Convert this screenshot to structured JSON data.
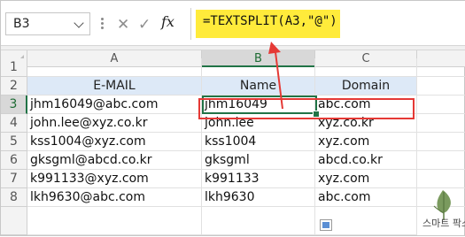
{
  "name_box": {
    "value": "B3"
  },
  "formula_bar": {
    "cancel_glyph": "✕",
    "enter_glyph": "✓",
    "fx_label": "fx",
    "formula": "=TEXTSPLIT(A3,\"@\")"
  },
  "columns": [
    "A",
    "B",
    "C"
  ],
  "rows": [
    "1",
    "2",
    "3",
    "4",
    "5",
    "6",
    "7",
    "8"
  ],
  "headers": {
    "email": "E-MAIL",
    "name": "Name",
    "domain": "Domain"
  },
  "data": [
    {
      "row": "3",
      "email": "jhm16049@abc.com",
      "name": "jhm16049",
      "domain": "abc.com"
    },
    {
      "row": "4",
      "email": "john.lee@xyz.co.kr",
      "name": "john.lee",
      "domain": "xyz.co.kr"
    },
    {
      "row": "5",
      "email": "kss1004@xyz.com",
      "name": "kss1004",
      "domain": "xyz.com"
    },
    {
      "row": "6",
      "email": "gksgml@abcd.co.kr",
      "name": "gksgml",
      "domain": "abcd.co.kr"
    },
    {
      "row": "7",
      "email": "k991133@xyz.com",
      "name": "k991133",
      "domain": "xyz.com"
    },
    {
      "row": "8",
      "email": "lkh9630@abc.com",
      "name": "lkh9630",
      "domain": "abc.com"
    }
  ],
  "watermark": {
    "text": "스마트 팍스"
  },
  "colors": {
    "formula_highlight": "#ffeb3b",
    "header_fill": "#dde9f7",
    "selection": "#217346",
    "annotation": "#e53935"
  }
}
